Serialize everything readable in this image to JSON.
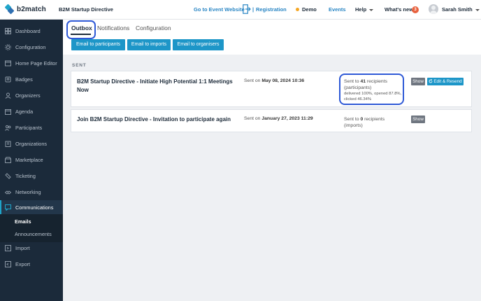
{
  "topbar": {
    "brand": "b2match",
    "event_name": "B2M Startup Directive",
    "go_to_event": "Go to Event Website",
    "separator": "|",
    "registration": "Registration",
    "demo": "Demo",
    "events": "Events",
    "help": "Help",
    "whats_new": "What's new",
    "whats_new_count": "3",
    "user_name": "Sarah Smith"
  },
  "sidebar": {
    "items": [
      {
        "label": "Dashboard",
        "icon": "dashboard-icon"
      },
      {
        "label": "Configuration",
        "icon": "configuration-icon"
      },
      {
        "label": "Home Page Editor",
        "icon": "home-page-editor-icon"
      },
      {
        "label": "Badges",
        "icon": "badge-icon"
      },
      {
        "label": "Organizers",
        "icon": "organizers-icon"
      },
      {
        "label": "Agenda",
        "icon": "agenda-icon"
      },
      {
        "label": "Participants",
        "icon": "participants-icon"
      },
      {
        "label": "Organizations",
        "icon": "organizations-icon"
      },
      {
        "label": "Marketplace",
        "icon": "marketplace-icon"
      },
      {
        "label": "Ticketing",
        "icon": "ticket-icon"
      },
      {
        "label": "Networking",
        "icon": "networking-icon"
      },
      {
        "label": "Communications",
        "icon": "communications-icon"
      },
      {
        "label": "Import",
        "icon": "import-icon"
      },
      {
        "label": "Export",
        "icon": "export-icon"
      }
    ],
    "sub_items": [
      "Emails",
      "Announcements"
    ]
  },
  "tabs": [
    "Outbox",
    "Notifications",
    "Configuration"
  ],
  "actions": [
    "Email to participants",
    "Email to imports",
    "Email to organisers"
  ],
  "section_label": "SENT",
  "emails": [
    {
      "title": "B2M Startup Directive - Initiate High Potential 1:1 Meetings Now",
      "sent_prefix": "Sent on ",
      "sent_date": "May 08, 2024 10:36",
      "recip_prefix": "Sent to ",
      "recip_count": "41",
      "recip_suffix": " recipients",
      "recip_group": "(participants)",
      "stats_line1": "delivered 100%, opened 87.8%,",
      "stats_line2": "clicked 46.34%",
      "show_label": "Show",
      "resend_label": "Edit & Resend"
    },
    {
      "title": "Join B2M Startup Directive - Invitation to participate again",
      "sent_prefix": "Sent on ",
      "sent_date": "January 27, 2023 11:29",
      "recip_prefix": "Sent to ",
      "recip_count": "0",
      "recip_suffix": " recipients",
      "recip_group": "(imports)",
      "show_label": "Show"
    }
  ],
  "colors": {
    "sidebar_bg": "#1b2a3a",
    "accent": "#1d96c8",
    "link": "#2a86c4",
    "highlight": "#2e59d6",
    "demo_dot": "#f5a623",
    "badge": "#e8623f"
  }
}
